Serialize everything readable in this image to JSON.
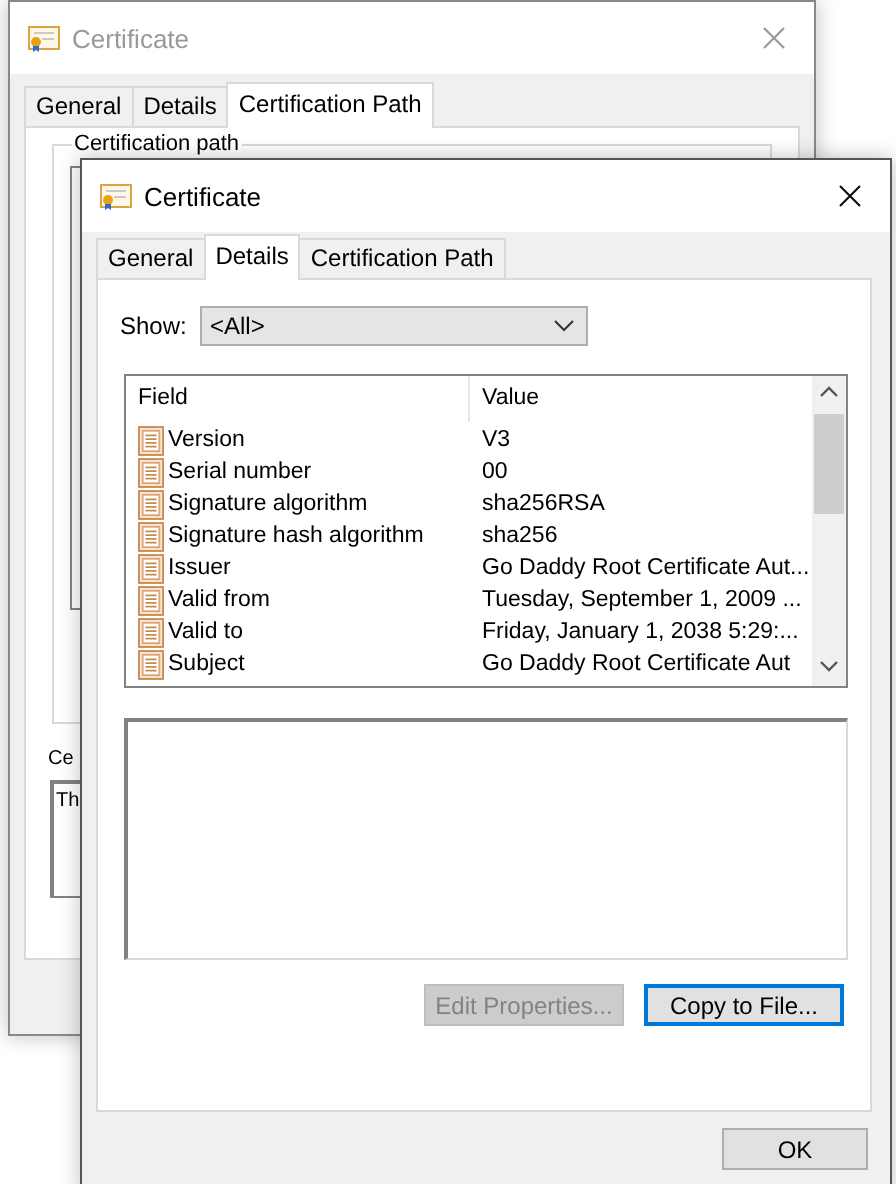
{
  "back_window": {
    "title": "Certificate",
    "active": false,
    "tabs": [
      {
        "label": "General",
        "selected": false
      },
      {
        "label": "Details",
        "selected": false
      },
      {
        "label": "Certification Path",
        "selected": true
      }
    ],
    "group_label": "Certification path",
    "status_label": "Ce",
    "status_text": "Th"
  },
  "front_window": {
    "title": "Certificate",
    "active": true,
    "tabs": [
      {
        "label": "General",
        "selected": false
      },
      {
        "label": "Details",
        "selected": true
      },
      {
        "label": "Certification Path",
        "selected": false
      }
    ],
    "show_label": "Show:",
    "show_value": "<All>",
    "columns": [
      "Field",
      "Value"
    ],
    "rows": [
      {
        "field": "Version",
        "value": "V3"
      },
      {
        "field": "Serial number",
        "value": "00"
      },
      {
        "field": "Signature algorithm",
        "value": "sha256RSA"
      },
      {
        "field": "Signature hash algorithm",
        "value": "sha256"
      },
      {
        "field": "Issuer",
        "value": "Go Daddy Root Certificate Aut..."
      },
      {
        "field": "Valid from",
        "value": "Tuesday, September 1, 2009 ..."
      },
      {
        "field": "Valid to",
        "value": "Friday, January 1, 2038 5:29:..."
      },
      {
        "field": "Subject",
        "value": "Go Daddy Root Certificate Aut"
      }
    ],
    "buttons": [
      {
        "label": "Edit Properties...",
        "disabled": true,
        "focused": false
      },
      {
        "label": "Copy to File...",
        "disabled": false,
        "focused": true
      }
    ],
    "ok_button": "OK"
  }
}
